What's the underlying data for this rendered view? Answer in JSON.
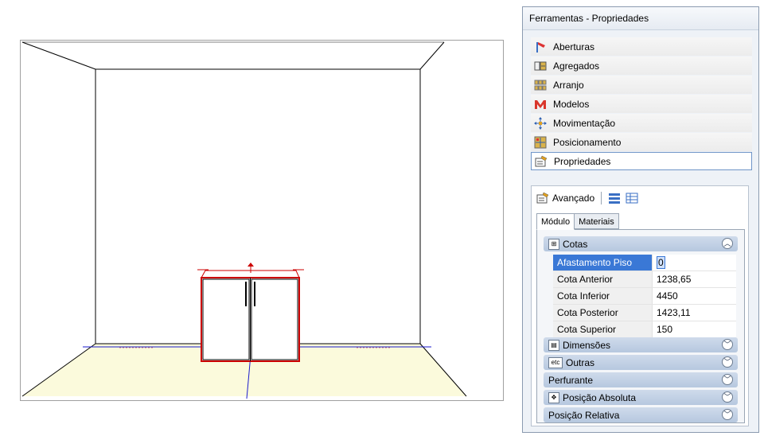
{
  "panel": {
    "title": "Ferramentas - Propriedades",
    "tools": [
      {
        "label": "Aberturas",
        "icon": "openings-icon"
      },
      {
        "label": "Agregados",
        "icon": "aggregates-icon"
      },
      {
        "label": "Arranjo",
        "icon": "arrangement-icon"
      },
      {
        "label": "Modelos",
        "icon": "models-icon"
      },
      {
        "label": "Movimentação",
        "icon": "move-icon"
      },
      {
        "label": "Posicionamento",
        "icon": "positioning-icon"
      },
      {
        "label": "Propriedades",
        "icon": "properties-icon"
      }
    ],
    "active_tool": "Propriedades"
  },
  "advanced": {
    "label": "Avançado",
    "tabs": [
      "Módulo",
      "Materiais"
    ],
    "active_tab": "Módulo",
    "groups": {
      "cotas": "Cotas",
      "dimensoes": "Dimensões",
      "outras": "Outras",
      "perfurante": "Perfurante",
      "posicao_absoluta": "Posição Absoluta",
      "posicao_relativa": "Posição Relativa"
    },
    "outras_icon_text": "etc",
    "properties": [
      {
        "name": "Afastamento Piso",
        "value": "0"
      },
      {
        "name": "Cota Anterior",
        "value": "1238,65"
      },
      {
        "name": "Cota Inferior",
        "value": "4450"
      },
      {
        "name": "Cota Posterior",
        "value": "1423,11"
      },
      {
        "name": "Cota Superior",
        "value": "150"
      }
    ]
  },
  "colors": {
    "floor": "#fbfadc",
    "selection": "#cc0000",
    "axis": "#1a1acc",
    "panel_accent": "#3a78d6"
  }
}
